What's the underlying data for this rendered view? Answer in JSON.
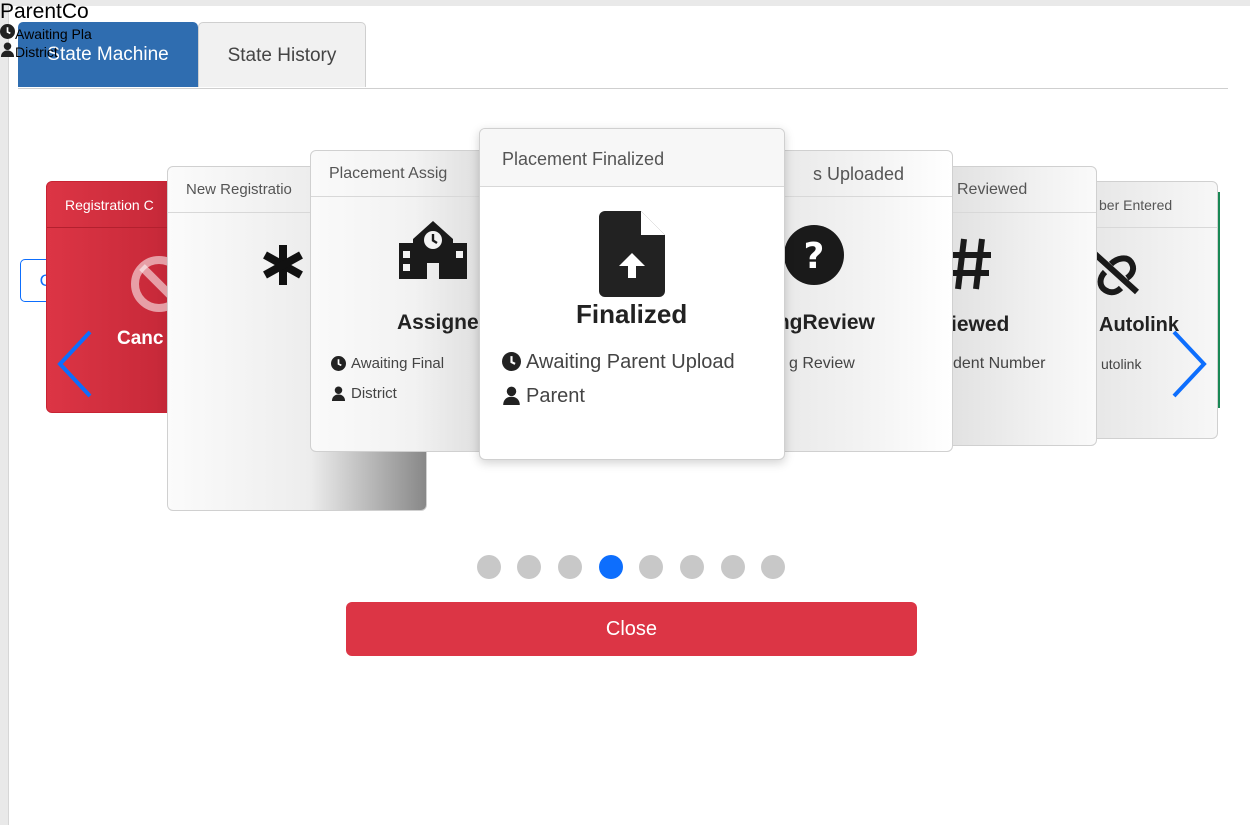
{
  "tabs": [
    {
      "label": "State Machine",
      "active": true
    },
    {
      "label": "State History",
      "active": false
    }
  ],
  "cards": {
    "cancelled": {
      "header": "Registration C",
      "title": "Canc"
    },
    "new": {
      "header": "New Registratio",
      "title": "ParentCo",
      "status": "Awaiting Pla",
      "role": "District",
      "current_label": "Current"
    },
    "assigned": {
      "header": "Placement Assig",
      "title": "Assigne",
      "status": "Awaiting Final",
      "role": "District"
    },
    "finalized": {
      "header": "Placement Finalized",
      "title": "Finalized",
      "status": "Awaiting Parent Upload",
      "role": "Parent"
    },
    "uploaded": {
      "header": "s Uploaded",
      "title": "ingReview",
      "status": "g Review"
    },
    "reviewed": {
      "header": "Reviewed",
      "title": "iewed",
      "status": "dent Number"
    },
    "number": {
      "header": "ber Entered",
      "title": "Autolink",
      "status": "utolink"
    }
  },
  "pagination": {
    "count": 8,
    "active_index": 3
  },
  "close_label": "Close",
  "colors": {
    "primary": "#0d6efd",
    "danger": "#dc3545",
    "tab_active": "#2f6db0",
    "success": "#198754"
  }
}
